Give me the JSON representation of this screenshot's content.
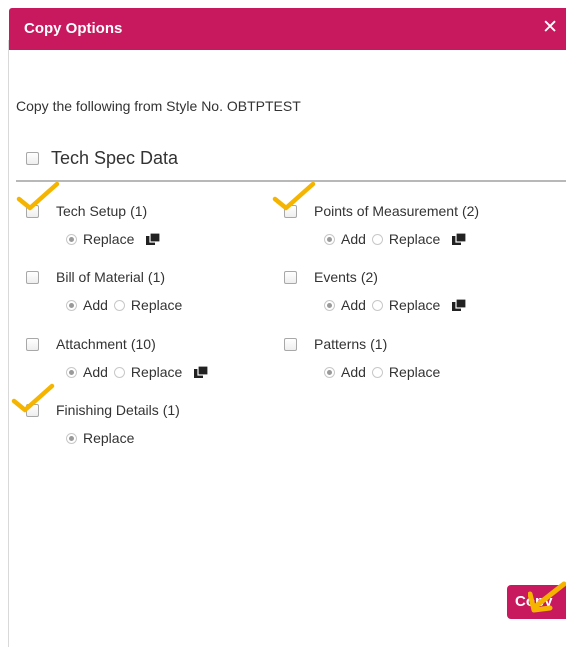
{
  "dialog": {
    "title": "Copy Options",
    "close_label": "✕"
  },
  "subtitle": "Copy the following from Style No. OBTPTEST",
  "section": {
    "title": "Tech Spec Data"
  },
  "items": [
    {
      "label": "Tech Setup",
      "count": "(1)",
      "options": [
        "Replace"
      ],
      "selected": "Replace",
      "has_copy_icon": true,
      "annotated": true
    },
    {
      "label": "Points of Measurement",
      "count": "(2)",
      "options": [
        "Add",
        "Replace"
      ],
      "selected": "Add",
      "has_copy_icon": true,
      "annotated": true
    },
    {
      "label": "Bill of Material",
      "count": "(1)",
      "options": [
        "Add",
        "Replace"
      ],
      "selected": "Add",
      "has_copy_icon": false,
      "annotated": false
    },
    {
      "label": "Events",
      "count": "(2)",
      "options": [
        "Add",
        "Replace"
      ],
      "selected": "Add",
      "has_copy_icon": true,
      "annotated": false
    },
    {
      "label": "Attachment",
      "count": "(10)",
      "options": [
        "Add",
        "Replace"
      ],
      "selected": "Add",
      "has_copy_icon": true,
      "annotated": false
    },
    {
      "label": "Patterns",
      "count": "(1)",
      "options": [
        "Add",
        "Replace"
      ],
      "selected": "Add",
      "has_copy_icon": false,
      "annotated": false
    },
    {
      "label": "Finishing Details",
      "count": "(1)",
      "options": [
        "Replace"
      ],
      "selected": "Replace",
      "has_copy_icon": false,
      "annotated": true
    }
  ],
  "copy_button": {
    "label": "Copy"
  },
  "colors": {
    "brand": "#c8195f",
    "annotation": "#f4b400"
  },
  "icons": {
    "close": "close-icon",
    "copy": "copy-icon",
    "annotation_check": "checkmark-annotation-icon",
    "annotation_arrow": "arrow-annotation-icon"
  }
}
